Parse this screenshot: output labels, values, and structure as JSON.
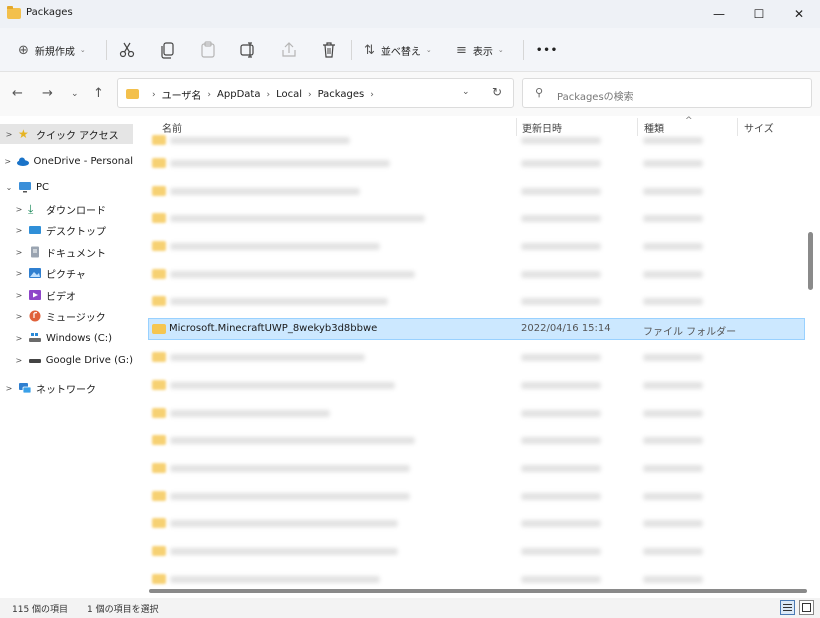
{
  "window": {
    "title": "Packages",
    "minimize_glyph": "—",
    "maximize_glyph": "☐",
    "close_glyph": "✕"
  },
  "ribbon": {
    "new_label": "新規作成",
    "new_icon": "⊕",
    "sort_label": "並べ替え",
    "sort_icon": "⇅",
    "view_label": "表示",
    "view_icon": "≡",
    "more_glyph": "•••",
    "chevron": "⌄"
  },
  "nav": {
    "back": "←",
    "forward": "→",
    "recent": "⌄",
    "up": "↑"
  },
  "address": {
    "crumbs": [
      "ユーザ名",
      "AppData",
      "Local",
      "Packages"
    ],
    "dropdown": "⌄",
    "refresh": "↻"
  },
  "search": {
    "icon": "⚲",
    "placeholder": "Packagesの検索"
  },
  "sidebar": {
    "items": [
      {
        "label": "クイック アクセス",
        "icon": "star-icon",
        "chevron": ">"
      },
      {
        "label": "OneDrive - Personal",
        "icon": "cloud-icon",
        "chevron": ">"
      },
      {
        "label": "PC",
        "icon": "monitor-icon",
        "chevron": "⌄"
      },
      {
        "label": "ダウンロード",
        "icon": "download-icon",
        "chevron": ">"
      },
      {
        "label": "デスクトップ",
        "icon": "desktop-icon",
        "chevron": ">"
      },
      {
        "label": "ドキュメント",
        "icon": "document-icon",
        "chevron": ">"
      },
      {
        "label": "ピクチャ",
        "icon": "pictures-icon",
        "chevron": ">"
      },
      {
        "label": "ビデオ",
        "icon": "video-icon",
        "chevron": ">"
      },
      {
        "label": "ミュージック",
        "icon": "music-icon",
        "chevron": ">"
      },
      {
        "label": "Windows (C:)",
        "icon": "drive-icon",
        "chevron": ">"
      },
      {
        "label": "Google Drive (G:)",
        "icon": "drive-icon",
        "chevron": ">"
      },
      {
        "label": "ネットワーク",
        "icon": "network-icon",
        "chevron": ">"
      }
    ]
  },
  "columns": {
    "name": "名前",
    "date": "更新日時",
    "type": "種類",
    "size": "サイズ",
    "sort_indicator": "^"
  },
  "files": {
    "selected": {
      "name": "Microsoft.MinecraftUWP_8wekyb3d8bbwe",
      "date": "2022/04/16 15:14",
      "type": "ファイル フォルダー"
    }
  },
  "status": {
    "count": "115 個の項目",
    "selection": "1 個の項目を選択"
  }
}
